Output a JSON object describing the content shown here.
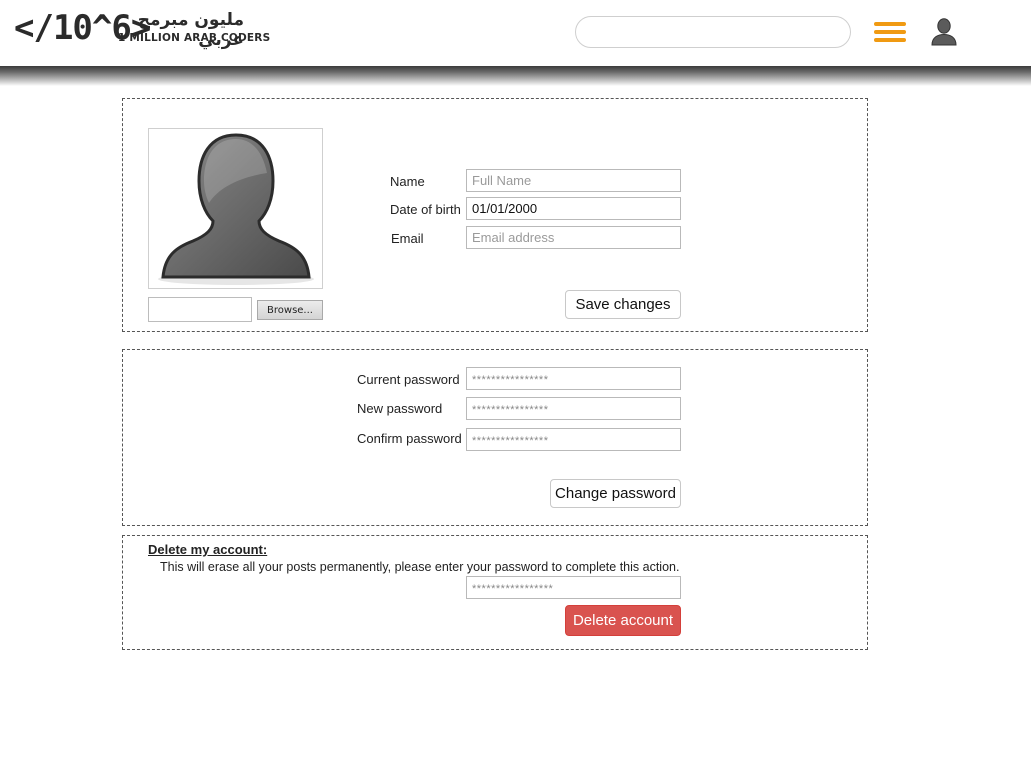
{
  "header": {
    "logo_mark": "</10^6>",
    "logo_arabic": "مليون مبرمج عربي",
    "logo_english": "1 MILLION ARAB CODERS",
    "search_placeholder": "",
    "menu_icon": "hamburger-menu-icon",
    "user_icon": "user-icon",
    "accent_color": "#f09a12"
  },
  "profile": {
    "avatar_icon": "avatar-silhouette-icon",
    "browse_label": "Browse...",
    "name_label": "Name",
    "name_placeholder": "Full Name",
    "name_value": "",
    "dob_label": "Date of birth",
    "dob_value": "01/01/2000",
    "email_label": "Email",
    "email_placeholder": "Email address",
    "email_value": "",
    "save_label": "Save changes"
  },
  "password": {
    "current_label": "Current password",
    "current_placeholder": "****************",
    "new_label": "New password",
    "new_placeholder": "****************",
    "confirm_label": "Confirm password",
    "confirm_placeholder": "****************",
    "change_label": "Change password"
  },
  "delete_account": {
    "heading": "Delete my account:",
    "description": "This will erase all your posts permanently, please enter your password to complete this action.",
    "password_placeholder": "*****************",
    "delete_label": "Delete account",
    "danger_color": "#d9534f"
  }
}
